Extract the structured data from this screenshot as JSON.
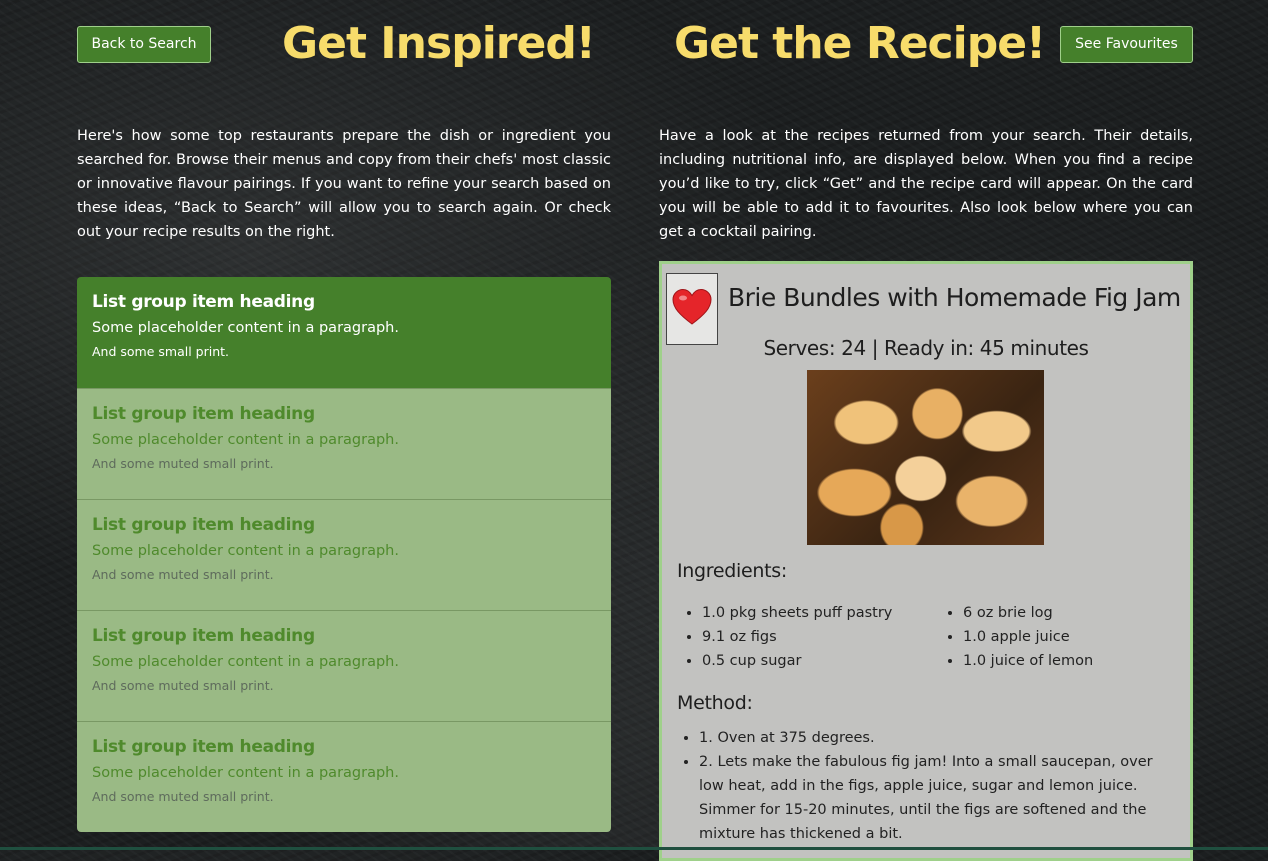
{
  "header": {
    "back_label": "Back to Search",
    "favourites_label": "See Favourites",
    "title_left": "Get Inspired!",
    "title_right": "Get the Recipe!"
  },
  "intro": {
    "left": "Here's how some top restaurants prepare the dish or ingredient you searched for. Browse their menus and copy from their chefs' most classic or innovative flavour pairings. If you want to refine your search based on these ideas, “Back to Search” will allow you to search again. Or check out your recipe results on the right.",
    "right": "Have a look at the recipes returned from your search. Their details, including nutritional info, are displayed below. When you find a recipe you’d like to try, click “Get” and the recipe card will appear. On the card you will be able to add it to favourites. Also look below where you can get a cocktail pairing."
  },
  "list_group": {
    "items": [
      {
        "heading": "List group item heading",
        "text": "Some placeholder content in a paragraph.",
        "small": "And some small print.",
        "active": true
      },
      {
        "heading": "List group item heading",
        "text": "Some placeholder content in a paragraph.",
        "small": "And some muted small print.",
        "active": false
      },
      {
        "heading": "List group item heading",
        "text": "Some placeholder content in a paragraph.",
        "small": "And some muted small print.",
        "active": false
      },
      {
        "heading": "List group item heading",
        "text": "Some placeholder content in a paragraph.",
        "small": "And some muted small print.",
        "active": false
      },
      {
        "heading": "List group item heading",
        "text": "Some placeholder content in a paragraph.",
        "small": "And some muted small print.",
        "active": false
      }
    ]
  },
  "recipe": {
    "favourite_icon": "heart-icon",
    "title": "Brie Bundles with Homemade Fig Jam",
    "serves_line": "Serves: 24 | Ready in: 45 minutes",
    "ingredients_heading": "Ingredients:",
    "ingredients_left": [
      "1.0 pkg sheets puff pastry",
      "9.1 oz figs",
      "0.5 cup sugar"
    ],
    "ingredients_right": [
      "6 oz brie log",
      "1.0 apple juice",
      "1.0 juice of lemon"
    ],
    "method_heading": "Method:",
    "method": [
      "1. Oven at 375 degrees.",
      "2. Lets make the fabulous fig jam! Into a small saucepan, over low heat, add in the figs, apple juice, sugar and lemon juice. Simmer for 15-20 minutes, until the figs are softened and the mixture has thickened a bit."
    ]
  },
  "colors": {
    "accent_green": "#45802b",
    "title_yellow": "#f7dc6b",
    "list_bg": "#9aba85",
    "card_bg": "#c2c2c0",
    "heart_red": "#e5252a"
  }
}
